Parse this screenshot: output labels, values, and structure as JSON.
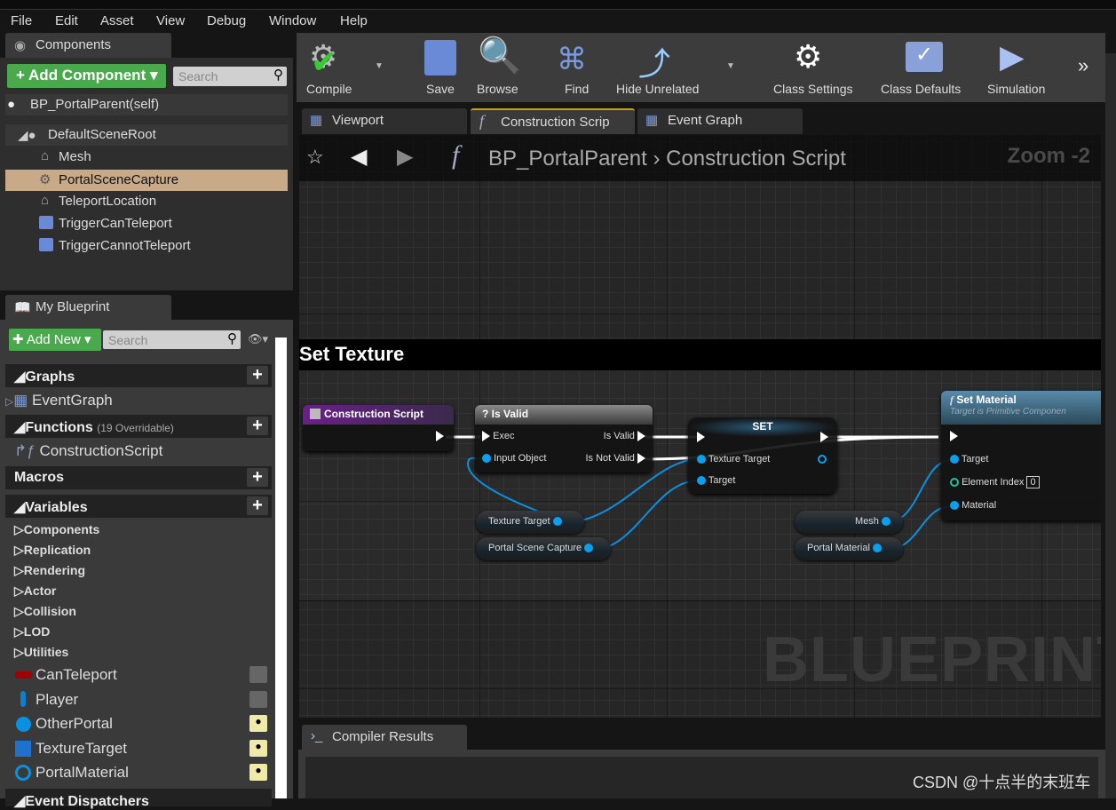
{
  "menu": [
    "File",
    "Edit",
    "Asset",
    "View",
    "Debug",
    "Window",
    "Help"
  ],
  "components": {
    "tab": "Components",
    "add_button": "Add Component",
    "search_placeholder": "Search",
    "self": "BP_PortalParent(self)",
    "tree": [
      "DefaultSceneRoot",
      "Mesh",
      "PortalSceneCapture",
      "TeleportLocation",
      "TriggerCanTeleport",
      "TriggerCannotTeleport"
    ],
    "selected": "PortalSceneCapture"
  },
  "my_blueprint": {
    "tab": "My Blueprint",
    "add_button": "Add New",
    "search_placeholder": "Search",
    "graphs": {
      "label": "Graphs",
      "items": [
        "EventGraph"
      ]
    },
    "functions": {
      "label": "Functions",
      "note": "(19 Overridable)",
      "items": [
        "ConstructionScript"
      ]
    },
    "macros": {
      "label": "Macros"
    },
    "variables": {
      "label": "Variables",
      "categories": [
        "Components",
        "Replication",
        "Rendering",
        "Actor",
        "Collision",
        "LOD",
        "Utilities"
      ],
      "items": [
        {
          "name": "CanTeleport",
          "color": "#a00000",
          "visible": false
        },
        {
          "name": "Player",
          "color": "#0a80d0",
          "visible": false
        },
        {
          "name": "OtherPortal",
          "color": "#0a90e0",
          "visible": true
        },
        {
          "name": "TextureTarget",
          "color": "#2070d0",
          "visible": true
        },
        {
          "name": "PortalMaterial",
          "color": "#0a90e0",
          "visible": true
        }
      ]
    },
    "event_dispatchers": {
      "label": "Event Dispatchers"
    }
  },
  "toolbar": [
    "Compile",
    "Save",
    "Browse",
    "Find",
    "Hide Unrelated",
    "Class Settings",
    "Class Defaults",
    "Simulation"
  ],
  "editor_tabs": [
    "Viewport",
    "Construction Scrip",
    "Event Graph"
  ],
  "active_tab": "Construction Scrip",
  "breadcrumb": {
    "root": "BP_PortalParent",
    "current": "Construction Script",
    "zoom": "Zoom -2"
  },
  "graph": {
    "comment": "Set Texture",
    "watermark": "BLUEPRINT",
    "nodes": {
      "construction": {
        "title": "Construction Script"
      },
      "isvalid": {
        "title": "Is Valid",
        "pins": [
          "Exec",
          "Input Object",
          "Is Valid",
          "Is Not Valid"
        ]
      },
      "set": {
        "title": "SET",
        "pins": [
          "Texture Target",
          "Target"
        ]
      },
      "setmaterial": {
        "title": "Set Material",
        "subtitle": "Target is Primitive Componen",
        "pins": [
          "Target",
          "Element Index",
          "Material"
        ],
        "element_index": "0"
      },
      "getters": [
        "Texture Target",
        "Portal Scene Capture",
        "Mesh",
        "Portal Material"
      ]
    }
  },
  "compiler": {
    "tab": "Compiler Results"
  },
  "watermark_text": "CSDN @十点半的末班车",
  "colors": {
    "accent_green": "#4aa84d",
    "selection": "#c8aa88",
    "object_pin": "#0aa0f0",
    "int_pin": "#20c0a0"
  }
}
